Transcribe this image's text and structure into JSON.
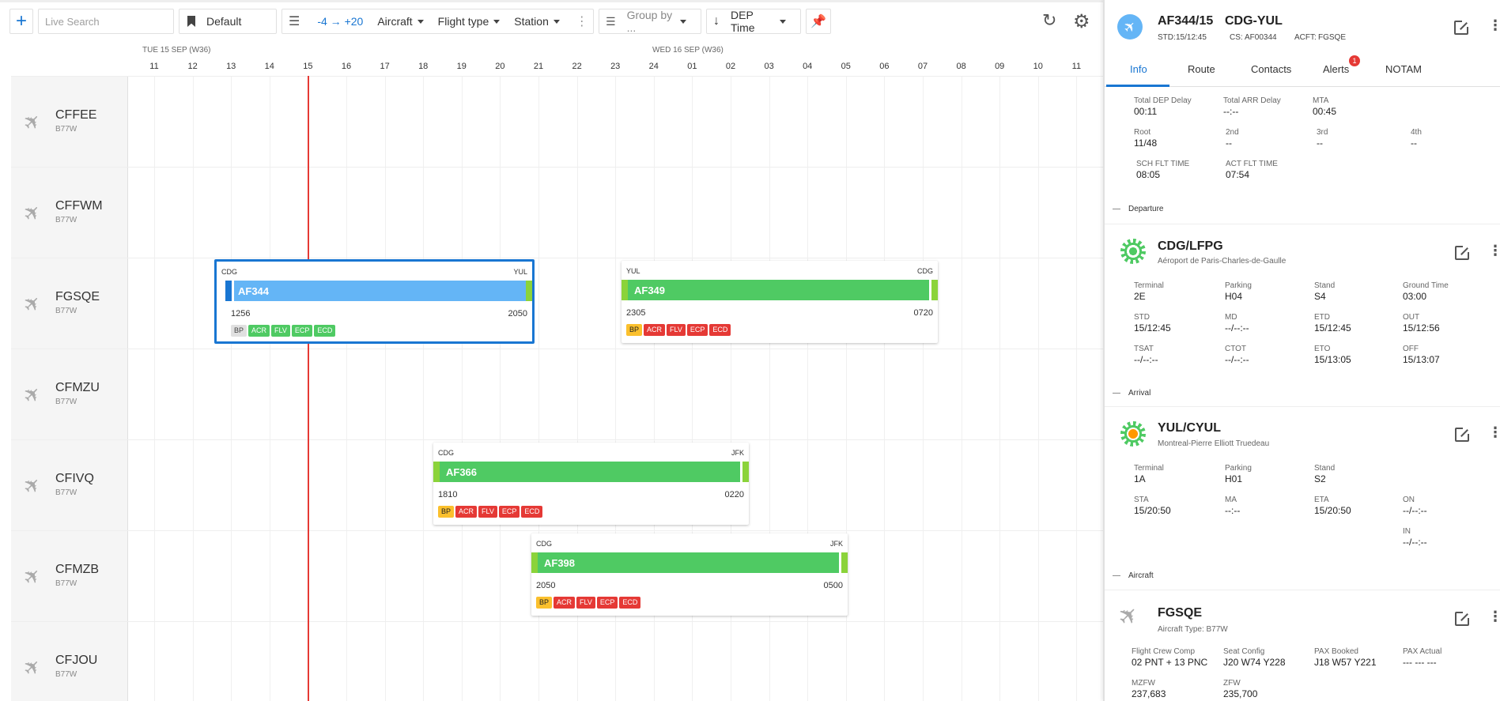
{
  "toolbar": {
    "search_placeholder": "Live Search",
    "view_name": "Default",
    "range": "-4 → +20",
    "filters": [
      "Aircraft",
      "Flight type",
      "Station"
    ],
    "group_by_placeholder": "Group by ...",
    "sort_label": "DEP Time"
  },
  "timeline": {
    "day1": "TUE 15 SEP (W36)",
    "day2": "WED 16 SEP (W36)",
    "hours": [
      "11",
      "12",
      "13",
      "14",
      "15",
      "16",
      "17",
      "18",
      "19",
      "20",
      "21",
      "22",
      "23",
      "24",
      "01",
      "02",
      "03",
      "04",
      "05",
      "06",
      "07",
      "08",
      "09",
      "10",
      "11"
    ]
  },
  "rows": [
    {
      "reg": "CFFEE",
      "type": "B77W"
    },
    {
      "reg": "CFFWM",
      "type": "B77W"
    },
    {
      "reg": "FGSQE",
      "type": "B77W"
    },
    {
      "reg": "CFMZU",
      "type": "B77W"
    },
    {
      "reg": "CFIVQ",
      "type": "B77W"
    },
    {
      "reg": "CFMZB",
      "type": "B77W"
    },
    {
      "reg": "CFJOU",
      "type": "B77W"
    }
  ],
  "flights": [
    {
      "flight": "AF344",
      "from": "CDG",
      "to": "YUL",
      "dep": "1256",
      "arr": "2050",
      "tags": [
        "BP",
        "ACR",
        "FLV",
        "ECP",
        "ECD"
      ]
    },
    {
      "flight": "AF349",
      "from": "YUL",
      "to": "CDG",
      "dep": "2305",
      "arr": "0720",
      "tags": [
        "BP",
        "ACR",
        "FLV",
        "ECP",
        "ECD"
      ]
    },
    {
      "flight": "AF366",
      "from": "CDG",
      "to": "JFK",
      "dep": "1810",
      "arr": "0220",
      "tags": [
        "BP",
        "ACR",
        "FLV",
        "ECP",
        "ECD"
      ]
    },
    {
      "flight": "AF398",
      "from": "CDG",
      "to": "JFK",
      "dep": "2050",
      "arr": "0500",
      "tags": [
        "BP",
        "ACR",
        "FLV",
        "ECP",
        "ECD"
      ]
    }
  ],
  "panel": {
    "flight": "AF344/15",
    "route": "CDG-YUL",
    "std_label": "STD:",
    "std": "15/12:45",
    "cs_label": "CS:",
    "cs": "AF00344",
    "acft_label": "ACFT:",
    "acft": "FGSQE",
    "tabs": [
      "Info",
      "Route",
      "Contacts",
      "Alerts",
      "NOTAM"
    ],
    "alerts_count": "1",
    "summary": [
      {
        "label": "Total DEP Delay",
        "value": "00:11"
      },
      {
        "label": "Total ARR Delay",
        "value": "--:--"
      },
      {
        "label": "MTA",
        "value": "00:45"
      },
      {
        "label": "Root",
        "value": "11/48"
      },
      {
        "label": "2nd",
        "value": "--"
      },
      {
        "label": "3rd",
        "value": "--"
      },
      {
        "label": "4th",
        "value": "--"
      },
      {
        "label": "SCH FLT TIME",
        "value": "08:05"
      },
      {
        "label": "ACT FLT TIME",
        "value": "07:54"
      }
    ],
    "departure": {
      "section": "Departure",
      "code": "CDG/LFPG",
      "name": "Aéroport de Paris-Charles-de-Gaulle",
      "fields": [
        {
          "label": "Terminal",
          "value": "2E"
        },
        {
          "label": "Parking",
          "value": "H04"
        },
        {
          "label": "Stand",
          "value": "S4"
        },
        {
          "label": "Ground Time",
          "value": "03:00"
        },
        {
          "label": "STD",
          "value": "15/12:45"
        },
        {
          "label": "MD",
          "value": "--/--:--"
        },
        {
          "label": "ETD",
          "value": "15/12:45"
        },
        {
          "label": "OUT",
          "value": "15/12:56"
        },
        {
          "label": "TSAT",
          "value": "--/--:--"
        },
        {
          "label": "CTOT",
          "value": "--/--:--"
        },
        {
          "label": "ETO",
          "value": "15/13:05"
        },
        {
          "label": "OFF",
          "value": "15/13:07"
        }
      ]
    },
    "arrival": {
      "section": "Arrival",
      "code": "YUL/CYUL",
      "name": "Montreal-Pierre Elliott Truedeau",
      "fields": [
        {
          "label": "Terminal",
          "value": "1A"
        },
        {
          "label": "Parking",
          "value": "H01"
        },
        {
          "label": "Stand",
          "value": "S2"
        },
        {
          "label": "STA",
          "value": "15/20:50"
        },
        {
          "label": "MA",
          "value": "--:--"
        },
        {
          "label": "ETA",
          "value": "15/20:50"
        },
        {
          "label": "ON",
          "value": "--/--:--"
        },
        {
          "label": "IN",
          "value": "--/--:--"
        }
      ]
    },
    "aircraft": {
      "section": "Aircraft",
      "reg": "FGSQE",
      "type_line": "Aircraft Type: B77W",
      "fields": [
        {
          "label": "Flight Crew Comp",
          "value": "02 PNT + 13 PNC"
        },
        {
          "label": "Seat Config",
          "value": "J20 W74 Y228"
        },
        {
          "label": "PAX Booked",
          "value": "J18 W57 Y221"
        },
        {
          "label": "PAX Actual",
          "value": "--- --- ---"
        },
        {
          "label": "MZFW",
          "value": "237,683"
        },
        {
          "label": "ZFW",
          "value": "235,700"
        }
      ]
    }
  }
}
